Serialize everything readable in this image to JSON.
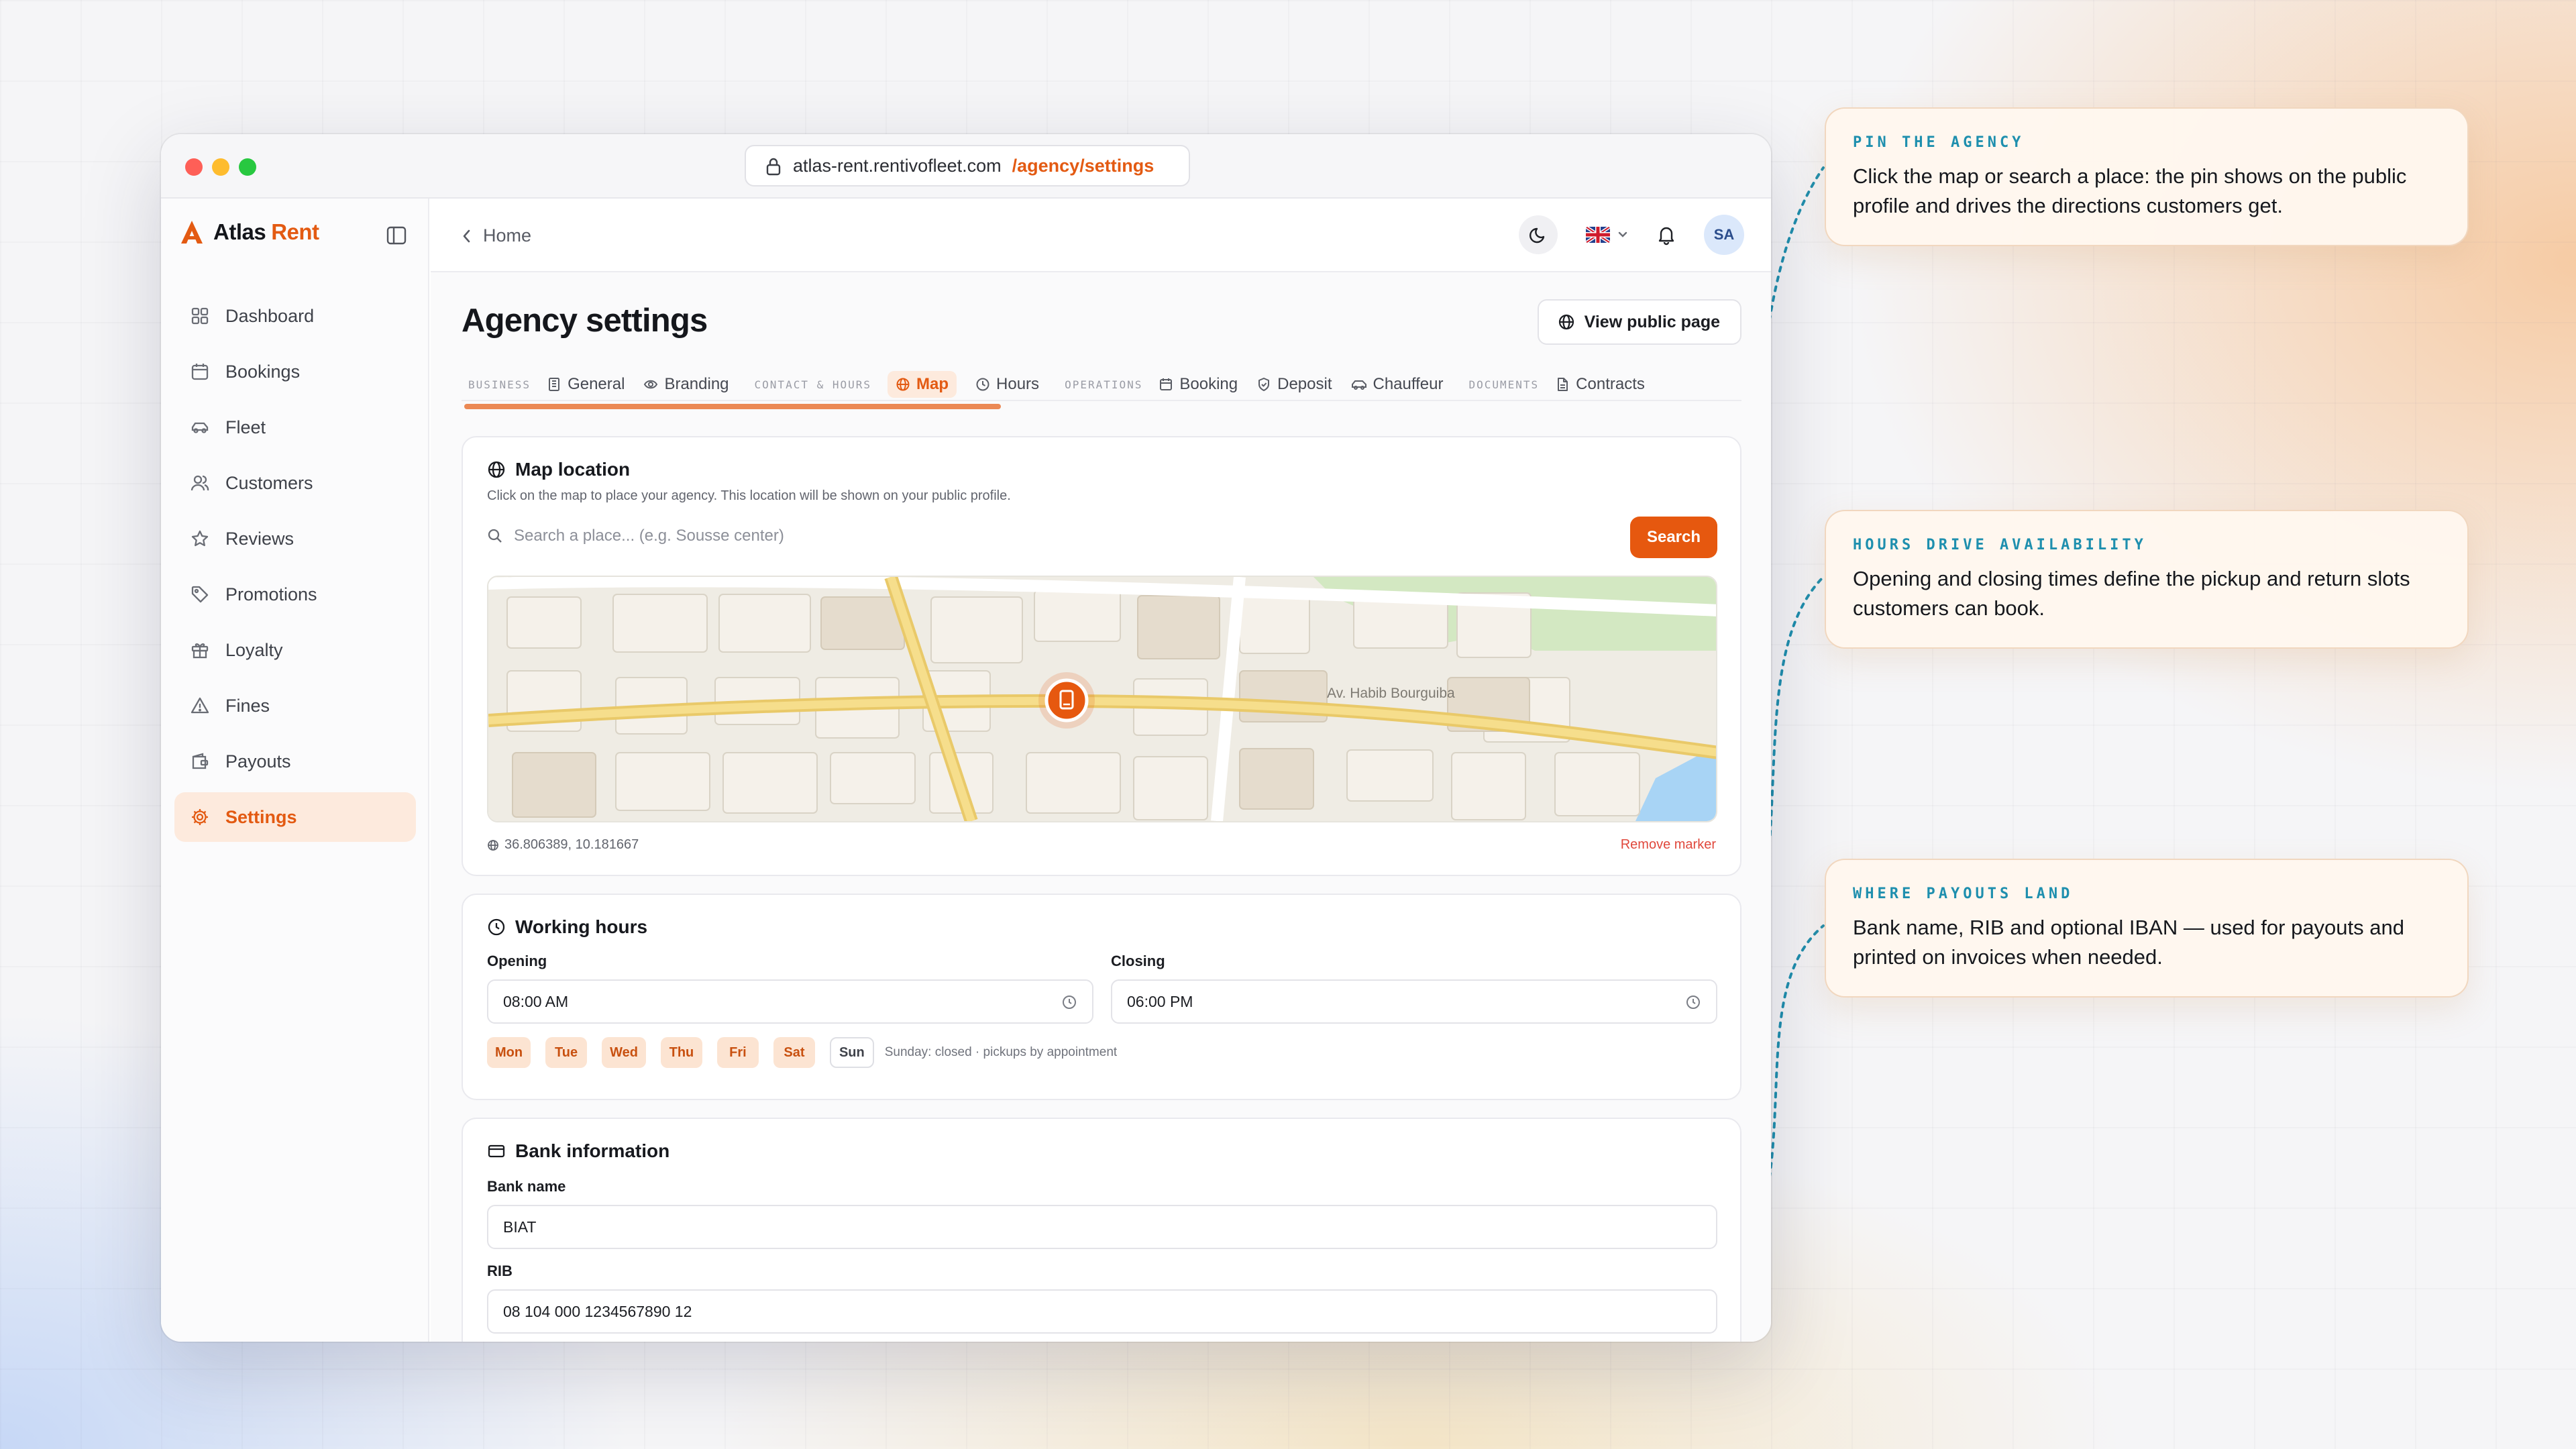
{
  "browser": {
    "url_host": "atlas-rent.rentivofleet.com",
    "url_path": "/agency/settings"
  },
  "brand": {
    "name_part1": "Atlas",
    "name_part2": "Rent",
    "accent": "#e35a12"
  },
  "sidebar": {
    "items": [
      {
        "label": "Dashboard",
        "icon": "grid-icon"
      },
      {
        "label": "Bookings",
        "icon": "calendar-icon"
      },
      {
        "label": "Fleet",
        "icon": "car-icon"
      },
      {
        "label": "Customers",
        "icon": "users-icon"
      },
      {
        "label": "Reviews",
        "icon": "star-icon"
      },
      {
        "label": "Promotions",
        "icon": "tag-icon"
      },
      {
        "label": "Loyalty",
        "icon": "gift-icon"
      },
      {
        "label": "Fines",
        "icon": "warning-icon"
      },
      {
        "label": "Payouts",
        "icon": "wallet-icon"
      },
      {
        "label": "Settings",
        "icon": "gear-icon",
        "active": true
      }
    ]
  },
  "header": {
    "breadcrumb": "Home",
    "avatar_initials": "SA",
    "language_flag": "uk-flag-icon"
  },
  "page": {
    "title": "Agency settings",
    "view_public_label": "View public page"
  },
  "tabs": {
    "group_business": "BUSINESS",
    "general": "General",
    "branding": "Branding",
    "group_contact": "CONTACT & HOURS",
    "map": "Map",
    "hours": "Hours",
    "group_operations": "OPERATIONS",
    "booking": "Booking",
    "deposit": "Deposit",
    "chauffeur": "Chauffeur",
    "group_documents": "DOCUMENTS",
    "contracts": "Contracts",
    "active": "Map"
  },
  "map_card": {
    "title": "Map location",
    "description": "Click on the map to place your agency. This location will be shown on your public profile.",
    "search_placeholder": "Search a place... (e.g. Sousse center)",
    "search_button": "Search",
    "street_label": "Av. Habib Bourguiba",
    "coordinates": "36.806389, 10.181667",
    "remove_marker": "Remove marker"
  },
  "hours_card": {
    "title": "Working hours",
    "opening_label": "Opening",
    "opening_value": "08:00 AM",
    "closing_label": "Closing",
    "closing_value": "06:00 PM",
    "days": [
      {
        "label": "Mon",
        "open": true
      },
      {
        "label": "Tue",
        "open": true
      },
      {
        "label": "Wed",
        "open": true
      },
      {
        "label": "Thu",
        "open": true
      },
      {
        "label": "Fri",
        "open": true
      },
      {
        "label": "Sat",
        "open": true
      },
      {
        "label": "Sun",
        "open": false
      }
    ],
    "note": "Sunday: closed · pickups by appointment"
  },
  "bank_card": {
    "title": "Bank information",
    "bank_name_label": "Bank name",
    "bank_name_value": "BIAT",
    "rib_label": "RIB",
    "rib_value": "08 104 000 1234567890 12"
  },
  "callouts": [
    {
      "kicker": "PIN THE AGENCY",
      "text": "Click the map or search a place: the pin shows on the public profile and drives the directions customers get."
    },
    {
      "kicker": "HOURS DRIVE AVAILABILITY",
      "text": "Opening and closing times define the pickup and return slots customers can book."
    },
    {
      "kicker": "WHERE PAYOUTS LAND",
      "text": "Bank name, RIB and optional IBAN — used for payouts and printed on invoices when needed."
    }
  ],
  "colors": {
    "accent_orange": "#e6580f",
    "callout_teal": "#1e8fae",
    "map_road": "#f1d37a",
    "map_water": "#a8d4f5",
    "map_park": "#d3e8c2"
  }
}
